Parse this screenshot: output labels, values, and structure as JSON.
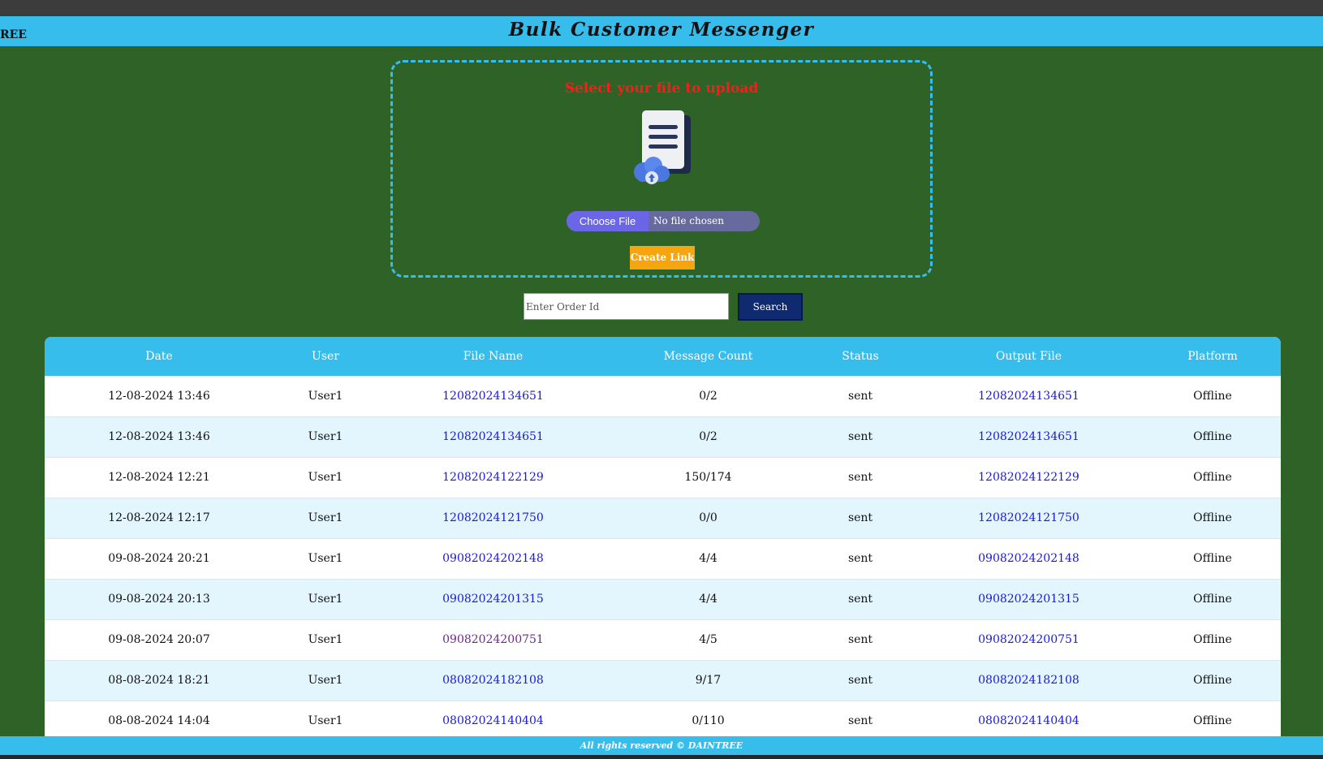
{
  "header": {
    "brand_fragment": "REE",
    "title": "Bulk Customer Messenger"
  },
  "upload": {
    "heading": "Select your file to upload",
    "choose_file_label": "Choose File",
    "no_file_text": "No file chosen",
    "create_link_label": "Create Link"
  },
  "search": {
    "placeholder": "Enter Order Id",
    "button_label": "Search"
  },
  "table": {
    "columns": [
      "Date",
      "User",
      "File Name",
      "Message Count",
      "Status",
      "Output File",
      "Platform"
    ],
    "rows": [
      {
        "date": "12-08-2024 13:46",
        "user": "User1",
        "file_name": "12082024134651",
        "message_count": "0/2",
        "status": "sent",
        "output_file": "12082024134651",
        "platform": "Offline"
      },
      {
        "date": "12-08-2024 13:46",
        "user": "User1",
        "file_name": "12082024134651",
        "message_count": "0/2",
        "status": "sent",
        "output_file": "12082024134651",
        "platform": "Offline"
      },
      {
        "date": "12-08-2024 12:21",
        "user": "User1",
        "file_name": "12082024122129",
        "message_count": "150/174",
        "status": "sent",
        "output_file": "12082024122129",
        "platform": "Offline"
      },
      {
        "date": "12-08-2024 12:17",
        "user": "User1",
        "file_name": "12082024121750",
        "message_count": "0/0",
        "status": "sent",
        "output_file": "12082024121750",
        "platform": "Offline"
      },
      {
        "date": "09-08-2024 20:21",
        "user": "User1",
        "file_name": "09082024202148",
        "message_count": "4/4",
        "status": "sent",
        "output_file": "09082024202148",
        "platform": "Offline"
      },
      {
        "date": "09-08-2024 20:13",
        "user": "User1",
        "file_name": "09082024201315",
        "message_count": "4/4",
        "status": "sent",
        "output_file": "09082024201315",
        "platform": "Offline"
      },
      {
        "date": "09-08-2024 20:07",
        "user": "User1",
        "file_name": "09082024200751",
        "message_count": "4/5",
        "status": "sent",
        "output_file": "09082024200751",
        "platform": "Offline"
      },
      {
        "date": "08-08-2024 18:21",
        "user": "User1",
        "file_name": "08082024182108",
        "message_count": "9/17",
        "status": "sent",
        "output_file": "08082024182108",
        "platform": "Offline"
      },
      {
        "date": "08-08-2024 14:04",
        "user": "User1",
        "file_name": "08082024140404",
        "message_count": "0/110",
        "status": "sent",
        "output_file": "08082024140404",
        "platform": "Offline"
      }
    ]
  },
  "footer": {
    "text": "All rights reserved © DAINTREE"
  },
  "colors": {
    "background": "#2f6227",
    "accent": "#36bdec",
    "create_button": "#f6a50f",
    "search_button": "#0f2a6e",
    "heading_red": "#ff1a1a",
    "link_blue": "#1a1ad6"
  },
  "icons": {
    "upload": "file-upload-icon"
  }
}
